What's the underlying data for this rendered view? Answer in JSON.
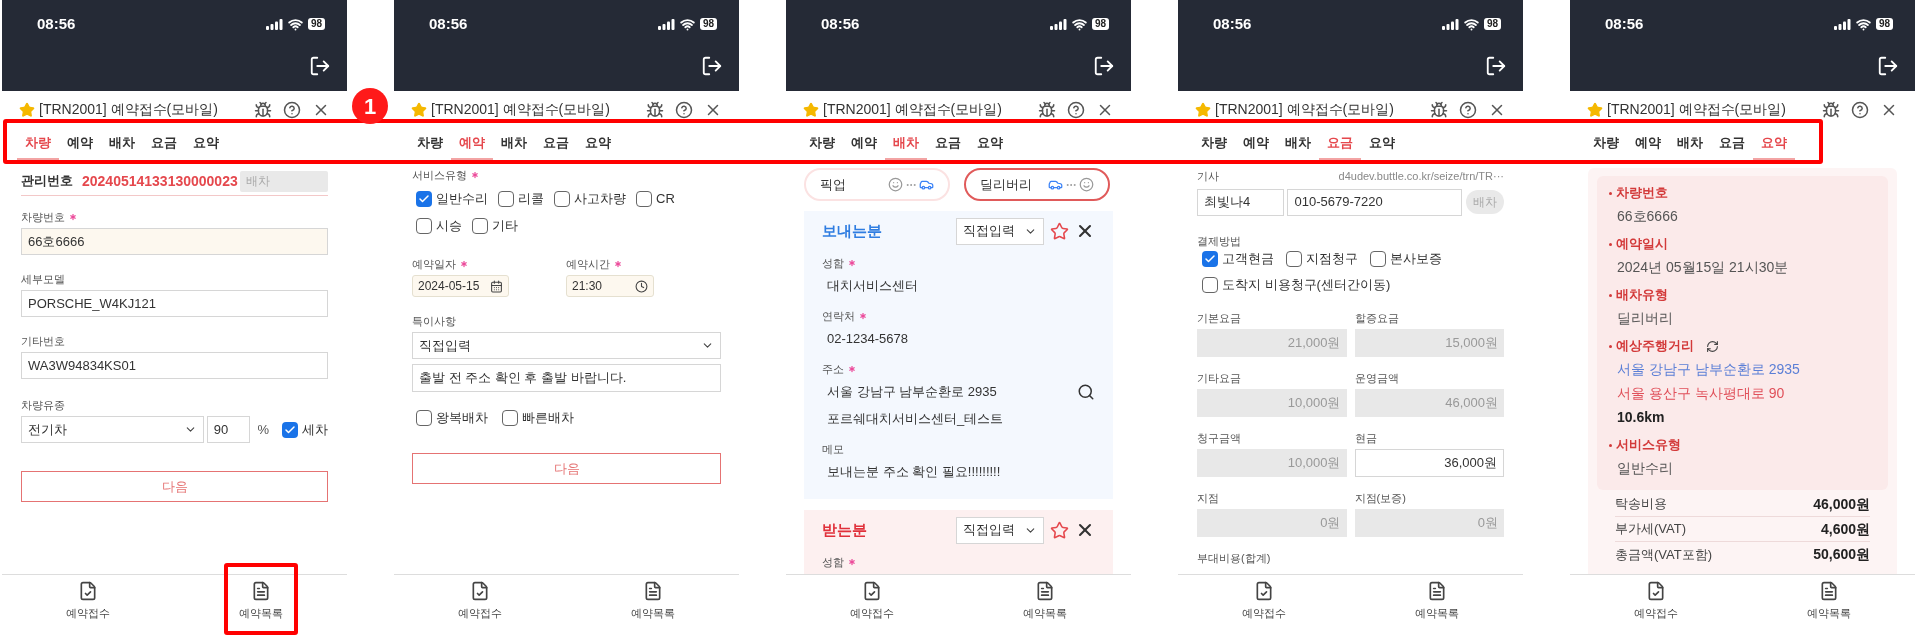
{
  "annotation": {
    "badge": "1"
  },
  "screens": [
    {
      "kind": "vehicle",
      "time": "08:56",
      "battery": "98",
      "title": "[TRN2001] 예약접수(모바일)",
      "tabs": [
        {
          "label": "차량",
          "selected": true
        },
        {
          "label": "예약",
          "selected": false
        },
        {
          "label": "배차",
          "selected": false
        },
        {
          "label": "요금",
          "selected": false
        },
        {
          "label": "요약",
          "selected": false
        }
      ],
      "manage_label": "관리번호",
      "manage_no": "20240514133130000023",
      "dispatch_button": {
        "label": "배차",
        "disabled": true
      },
      "fields": [
        {
          "label": "차량번호",
          "required": true,
          "value": "66호6666",
          "highlighted": true
        },
        {
          "label": "세부모델",
          "required": false,
          "value": "PORSCHE_W4KJ121",
          "highlighted": false
        },
        {
          "label": "기타번호",
          "required": false,
          "value": "WA3W94834KS01",
          "highlighted": false
        }
      ],
      "fuel": {
        "label": "차량유종",
        "select": "전기차",
        "percent": "90",
        "unit": "%",
        "wash": {
          "label": "세차",
          "checked": true
        }
      },
      "next_button": "다음",
      "nav": [
        {
          "label": "예약접수"
        },
        {
          "label": "예약목록"
        }
      ]
    },
    {
      "kind": "reservation",
      "time": "08:56",
      "battery": "98",
      "title": "[TRN2001] 예약접수(모바일)",
      "tabs": [
        {
          "label": "차량",
          "selected": false
        },
        {
          "label": "예약",
          "selected": true
        },
        {
          "label": "배차",
          "selected": false
        },
        {
          "label": "요금",
          "selected": false
        },
        {
          "label": "요약",
          "selected": false
        }
      ],
      "service": {
        "label": "서비스유형",
        "required": true,
        "options": [
          {
            "label": "일반수리",
            "checked": true
          },
          {
            "label": "리콜",
            "checked": false
          },
          {
            "label": "사고차량",
            "checked": false
          },
          {
            "label": "CR",
            "checked": false
          },
          {
            "label": "시승",
            "checked": false
          },
          {
            "label": "기타",
            "checked": false
          }
        ]
      },
      "date": {
        "label": "예약일자",
        "required": true,
        "value": "2024-05-15"
      },
      "time_field": {
        "label": "예약시간",
        "required": true,
        "value": "21:30"
      },
      "notes": {
        "label": "특이사항",
        "select": "직접입력",
        "value": "출발 전 주소 확인 후 출발 바랍니다."
      },
      "options": [
        {
          "label": "왕복배차",
          "checked": false
        },
        {
          "label": "빠른배차",
          "checked": false
        }
      ],
      "next_button": "다음",
      "nav": [
        {
          "label": "예약접수"
        },
        {
          "label": "예약목록"
        }
      ]
    },
    {
      "kind": "dispatch",
      "time": "08:56",
      "battery": "98",
      "title": "[TRN2001] 예약접수(모바일)",
      "tabs": [
        {
          "label": "차량",
          "selected": false
        },
        {
          "label": "예약",
          "selected": false
        },
        {
          "label": "배차",
          "selected": true
        },
        {
          "label": "요금",
          "selected": false
        },
        {
          "label": "요약",
          "selected": false
        }
      ],
      "modes": [
        {
          "kind": "pickup",
          "label": "픽업",
          "selected": false
        },
        {
          "kind": "delivery",
          "label": "딜리버리",
          "selected": true
        }
      ],
      "parties": [
        {
          "kind": "sender",
          "title": "보내는분",
          "select": "직접입력",
          "fields": [
            {
              "kind": "text",
              "label": "성함",
              "required": true,
              "value": "대치서비스센터"
            },
            {
              "kind": "text",
              "label": "연락처",
              "required": true,
              "value": "02-1234-5678"
            },
            {
              "kind": "address",
              "label": "주소",
              "required": true,
              "value": "서울 강남구 남부순환로 2935",
              "detail": "포르쉐대치서비스센터_테스트"
            },
            {
              "kind": "text",
              "label": "메모",
              "required": false,
              "value": "보내는분 주소 확인 필요!!!!!!!!!"
            }
          ]
        },
        {
          "kind": "receiver",
          "title": "받는분",
          "select": "직접입력",
          "fields": [
            {
              "kind": "text",
              "label": "성함",
              "required": true
            }
          ]
        }
      ],
      "nav": [
        {
          "label": "예약접수"
        },
        {
          "label": "예약목록"
        }
      ]
    },
    {
      "kind": "fee",
      "time": "08:56",
      "battery": "98",
      "title": "[TRN2001] 예약접수(모바일)",
      "tabs": [
        {
          "label": "차량",
          "selected": false
        },
        {
          "label": "예약",
          "selected": false
        },
        {
          "label": "배차",
          "selected": false
        },
        {
          "label": "요금",
          "selected": true
        },
        {
          "label": "요약",
          "selected": false
        }
      ],
      "driver": {
        "label": "기사",
        "url": "d4udev.buttle.co.kr/seize/trn/TR···",
        "name": "최빛나4",
        "phone": "010-5679-7220",
        "button": {
          "label": "배차",
          "disabled": true
        }
      },
      "payment": {
        "label": "결제방법",
        "options": [
          {
            "label": "고객현금",
            "checked": true
          },
          {
            "label": "지점청구",
            "checked": false
          },
          {
            "label": "본사보증",
            "checked": false
          },
          {
            "label": "도착지 비용청구(센터간이동)",
            "checked": false
          }
        ]
      },
      "amounts": [
        {
          "label": "기본요금",
          "value": "21,000원",
          "disabled": true
        },
        {
          "label": "할증요금",
          "value": "15,000원",
          "disabled": true
        },
        {
          "label": "기타요금",
          "value": "10,000원",
          "disabled": true
        },
        {
          "label": "운영금액",
          "value": "46,000원",
          "disabled": true
        },
        {
          "label": "청구금액",
          "value": "10,000원",
          "disabled": true
        },
        {
          "label": "현금",
          "value": "36,000원",
          "disabled": false
        },
        {
          "label": "지점",
          "value": "0원",
          "disabled": true
        },
        {
          "label": "지점(보증)",
          "value": "0원",
          "disabled": true
        }
      ],
      "extra_label": "부대비용(합계)",
      "nav": [
        {
          "label": "예약접수"
        },
        {
          "label": "예약목록"
        }
      ]
    },
    {
      "kind": "summary",
      "time": "08:56",
      "battery": "98",
      "title": "[TRN2001] 예약접수(모바일)",
      "tabs": [
        {
          "label": "차량",
          "selected": false
        },
        {
          "label": "예약",
          "selected": false
        },
        {
          "label": "배차",
          "selected": false
        },
        {
          "label": "요금",
          "selected": false
        },
        {
          "label": "요약",
          "selected": true
        }
      ],
      "items": [
        {
          "label": "차량번호",
          "refresh": false,
          "lines": [
            {
              "kind": "plain",
              "text": "66호6666"
            }
          ]
        },
        {
          "label": "예약일시",
          "refresh": false,
          "lines": [
            {
              "kind": "plain",
              "text": "2024년 05월15일 21시30분"
            }
          ]
        },
        {
          "label": "배차유형",
          "refresh": false,
          "lines": [
            {
              "kind": "plain",
              "text": "딜리버리"
            }
          ]
        },
        {
          "label": "예상주행거리",
          "refresh": true,
          "lines": [
            {
              "kind": "origin",
              "text": "서울 강남구 남부순환로 2935"
            },
            {
              "kind": "destination",
              "text": "서울 용산구 녹사평대로 90"
            },
            {
              "kind": "distance",
              "text": "10.6km"
            }
          ]
        },
        {
          "label": "서비스유형",
          "refresh": false,
          "lines": [
            {
              "kind": "plain",
              "text": "일반수리"
            }
          ]
        }
      ],
      "prices": [
        {
          "label": "탁송비용",
          "value": "46,000원"
        },
        {
          "label": "부가세(VAT)",
          "value": "4,600원"
        },
        {
          "label": "총금액(VAT포함)",
          "value": "50,600원"
        }
      ],
      "nav": [
        {
          "label": "예약접수"
        },
        {
          "label": "예약목록"
        }
      ]
    }
  ]
}
